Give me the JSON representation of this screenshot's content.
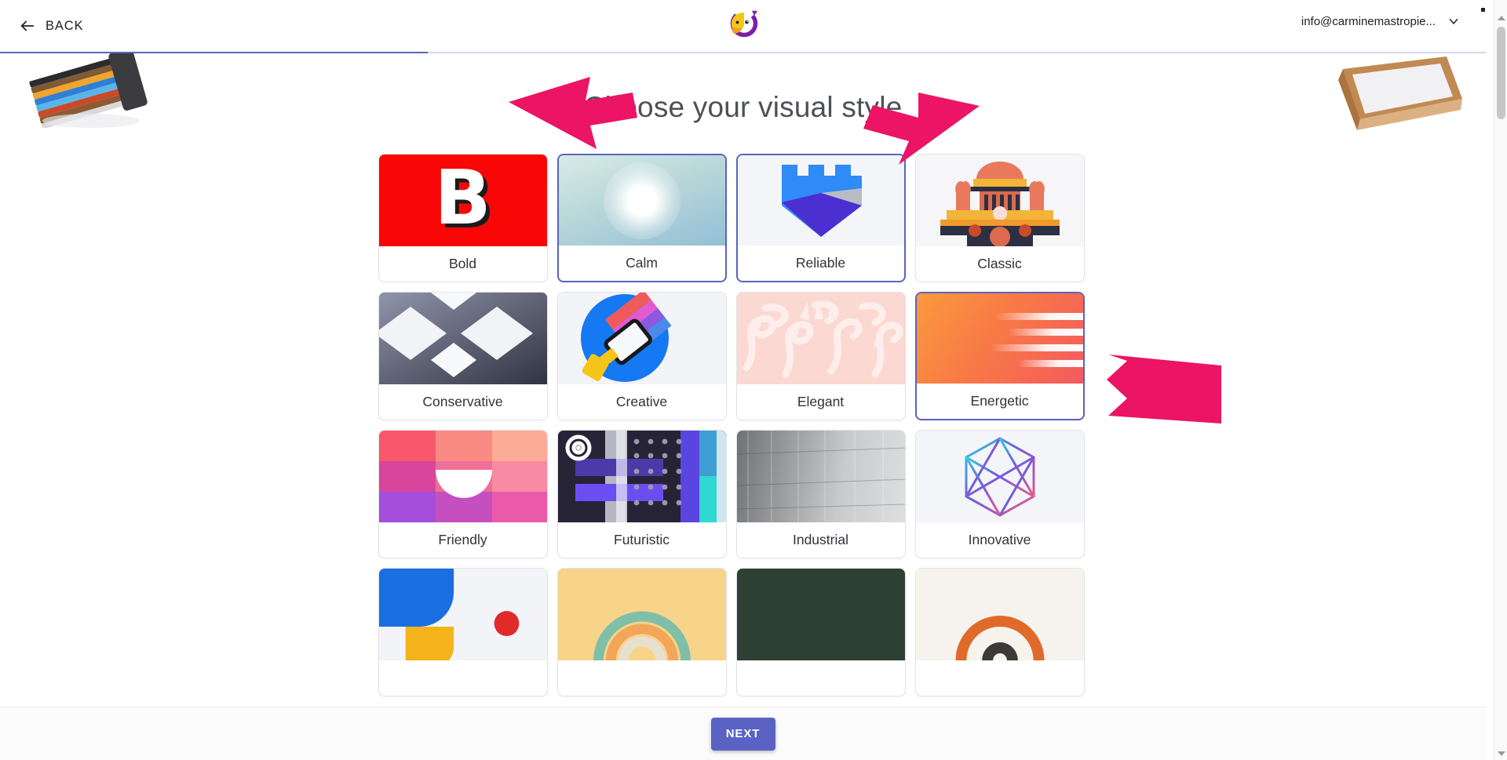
{
  "header": {
    "back_label": "BACK",
    "back_icon": "arrow-left-icon",
    "logo_icon": "parrot-logo-icon",
    "account_email": "info@carminemastropie...",
    "account_chevron_icon": "chevron-down-icon"
  },
  "progress": {
    "percent": 29
  },
  "main": {
    "title": "Choose your visual style"
  },
  "styles": [
    {
      "label": "Bold",
      "selected": false,
      "thumb": "t-bold",
      "glyph": "B"
    },
    {
      "label": "Calm",
      "selected": true,
      "thumb": "t-calm"
    },
    {
      "label": "Reliable",
      "selected": true,
      "thumb": "t-reliable"
    },
    {
      "label": "Classic",
      "selected": false,
      "thumb": "t-classic"
    },
    {
      "label": "Conservative",
      "selected": false,
      "thumb": "t-conservative"
    },
    {
      "label": "Creative",
      "selected": false,
      "thumb": "t-creative"
    },
    {
      "label": "Elegant",
      "selected": false,
      "thumb": "t-elegant"
    },
    {
      "label": "Energetic",
      "selected": true,
      "thumb": "t-energetic"
    },
    {
      "label": "Friendly",
      "selected": false,
      "thumb": "t-friendly"
    },
    {
      "label": "Futuristic",
      "selected": false,
      "thumb": "t-futuristic"
    },
    {
      "label": "Industrial",
      "selected": false,
      "thumb": "t-industrial"
    },
    {
      "label": "Innovative",
      "selected": false,
      "thumb": "t-innovative"
    }
  ],
  "footer": {
    "next_label": "NEXT"
  },
  "annotations": {
    "arrow_color": "#ec1464",
    "arrows": [
      {
        "target": "Calm"
      },
      {
        "target": "Reliable"
      },
      {
        "target": "Energetic"
      }
    ]
  },
  "colors": {
    "accent": "#5a63c4",
    "progress_track": "#d4d7ec",
    "title_text": "#4d5156",
    "card_border": "#e2e4ea"
  }
}
